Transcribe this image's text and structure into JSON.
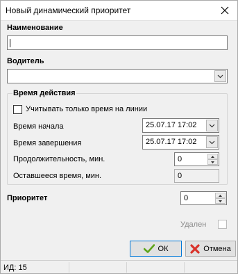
{
  "window": {
    "title": "Новый динамический приоритет"
  },
  "form": {
    "name_label": "Наименование",
    "name_value": "",
    "driver_label": "Водитель",
    "driver_value": ""
  },
  "time_group": {
    "title": "Время действия",
    "only_line_time_label": "Учитывать только время на линии",
    "only_line_time_checked": false,
    "start_label": "Время начала",
    "start_value": "25.07.17 17:02",
    "end_label": "Время завершения",
    "end_value": "25.07.17 17:02",
    "duration_label": "Продолжительность, мин.",
    "duration_value": "0",
    "remaining_label": "Оставшееся время, мин.",
    "remaining_value": "0"
  },
  "priority": {
    "label": "Приоритет",
    "value": "0"
  },
  "deleted": {
    "label": "Удален",
    "checked": false
  },
  "buttons": {
    "ok_label": "ОК",
    "cancel_label": "Отмена"
  },
  "status": {
    "id_text": "ИД: 15"
  },
  "icons": {
    "close": "close-icon",
    "ok": "checkmark-icon",
    "cancel": "red-x-icon",
    "dropdown": "chevron-down-icon"
  },
  "colors": {
    "ok_icon": "#5ea51b",
    "cancel_icon": "#d9322a",
    "focus_border": "#0078d7"
  }
}
